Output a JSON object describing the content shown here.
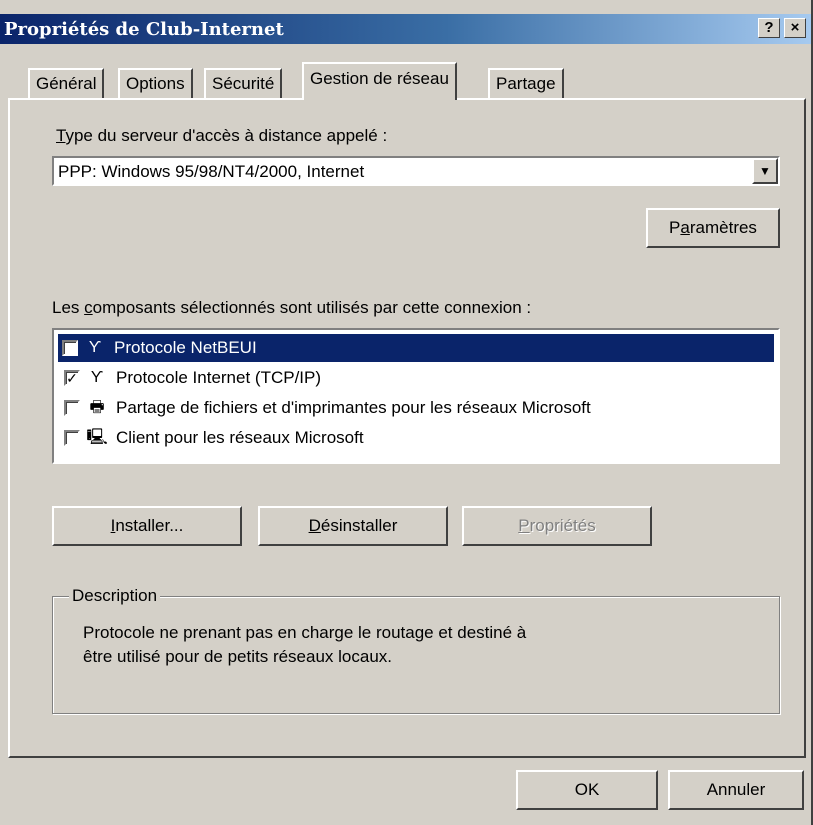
{
  "window": {
    "title": "Propriétés de Club-Internet",
    "help_label": "?",
    "close_label": "×"
  },
  "tabs": [
    {
      "label": "Général"
    },
    {
      "label": "Options"
    },
    {
      "label": "Sécurité"
    },
    {
      "label": "Gestion de réseau",
      "active": true
    },
    {
      "label": "Partage"
    }
  ],
  "server_type": {
    "label_first": "T",
    "label_rest": "ype du serveur d'accès à distance appelé :",
    "value": "PPP: Windows 95/98/NT4/2000, Internet",
    "params_first": "P",
    "params_u": "a",
    "params_rest": "ramètres"
  },
  "components": {
    "label_pre": "Les ",
    "label_u": "c",
    "label_rest": "omposants sélectionnés sont utilisés par cette connexion :",
    "items": [
      {
        "label": "Protocole NetBEUI",
        "checked": false,
        "selected": true,
        "icon": "network-protocol-icon"
      },
      {
        "label": "Protocole Internet (TCP/IP)",
        "checked": true,
        "selected": false,
        "icon": "network-protocol-icon"
      },
      {
        "label": "Partage de fichiers et d'imprimantes pour les réseaux Microsoft",
        "checked": false,
        "selected": false,
        "icon": "file-printer-sharing-icon"
      },
      {
        "label": "Client pour les réseaux Microsoft",
        "checked": false,
        "selected": false,
        "icon": "network-client-icon"
      }
    ]
  },
  "buttons": {
    "install_u": "I",
    "install_rest": "nstaller...",
    "uninstall_u": "D",
    "uninstall_rest": "ésinstaller",
    "properties_u": "P",
    "properties_rest": "ropriétés"
  },
  "description": {
    "legend": "Description",
    "line1": "Protocole ne prenant pas en charge le routage et destiné à",
    "line2": "être utilisé pour de petits réseaux locaux."
  },
  "footer": {
    "ok_label": "OK",
    "cancel_label": "Annuler"
  }
}
